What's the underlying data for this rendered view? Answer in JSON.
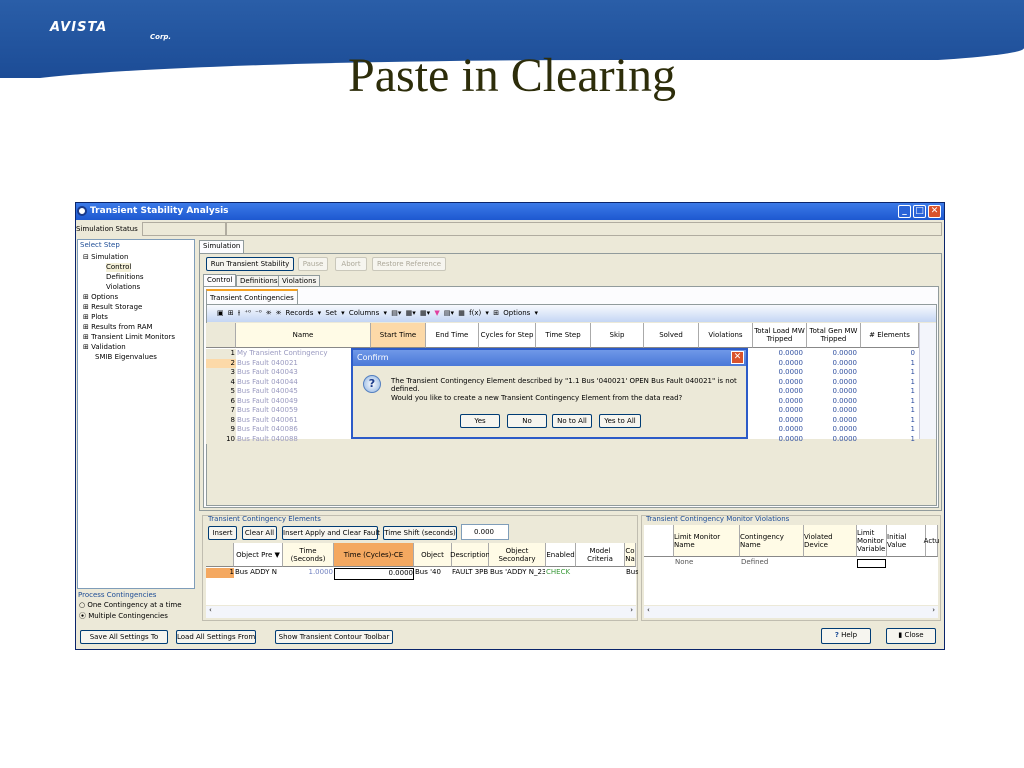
{
  "slide": {
    "logo": "AVISTA",
    "logo_sub": "Corp.",
    "title": "Paste in Clearing"
  },
  "window": {
    "title": "Transient Stability Analysis",
    "status_label": "Simulation Status"
  },
  "sidebar": {
    "header": "Select Step",
    "items": [
      {
        "label": "Simulation",
        "expander": "−"
      },
      {
        "label": "Control"
      },
      {
        "label": "Definitions"
      },
      {
        "label": "Violations"
      },
      {
        "label": "Options",
        "expander": "+"
      },
      {
        "label": "Result Storage",
        "expander": "+"
      },
      {
        "label": "Plots",
        "expander": "+"
      },
      {
        "label": "Results from RAM",
        "expander": "+"
      },
      {
        "label": "Transient Limit Monitors",
        "expander": "+"
      },
      {
        "label": "Validation",
        "expander": "+"
      },
      {
        "label": "SMIB Eigenvalues"
      }
    ],
    "process_header": "Process Contingencies",
    "process_options": [
      "One Contingency at a time",
      "Multiple Contingencies"
    ],
    "process_selected": 1
  },
  "main": {
    "tab": "Simulation",
    "buttons": {
      "run": "Run Transient Stability",
      "pause": "Pause",
      "abort": "Abort",
      "restore": "Restore Reference"
    },
    "subtabs": [
      "Control",
      "Definitions",
      "Violations"
    ],
    "inner_tab": "Transient Contingencies",
    "toolbar": {
      "records": "Records ▾",
      "set": "Set ▾",
      "columns": "Columns ▾",
      "fx": "f(x) ▾",
      "options": "Options ▾"
    },
    "columns": [
      "Name",
      "Start Time",
      "End Time",
      "Cycles for Step",
      "Time Step",
      "Skip",
      "Solved",
      "Violations",
      "Total Load MW Tripped",
      "Total Gen MW Tripped",
      "# Elements"
    ],
    "rows": [
      {
        "n": "1",
        "name": "My Transient Contingency",
        "load": "0.0000",
        "gen": "0.0000",
        "el": "0"
      },
      {
        "n": "2",
        "name": "Bus Fault 040021",
        "load": "0.0000",
        "gen": "0.0000",
        "el": "1"
      },
      {
        "n": "3",
        "name": "Bus Fault 040043",
        "load": "0.0000",
        "gen": "0.0000",
        "el": "1"
      },
      {
        "n": "4",
        "name": "Bus Fault 040044",
        "load": "0.0000",
        "gen": "0.0000",
        "el": "1"
      },
      {
        "n": "5",
        "name": "Bus Fault 040045",
        "load": "0.0000",
        "gen": "0.0000",
        "el": "1"
      },
      {
        "n": "6",
        "name": "Bus Fault 040049",
        "load": "0.0000",
        "gen": "0.0000",
        "el": "1"
      },
      {
        "n": "7",
        "name": "Bus Fault 040059",
        "load": "0.0000",
        "gen": "0.0000",
        "el": "1"
      },
      {
        "n": "8",
        "name": "Bus Fault 040061",
        "load": "0.0000",
        "gen": "0.0000",
        "el": "1"
      },
      {
        "n": "9",
        "name": "Bus Fault 040086",
        "load": "0.0000",
        "gen": "0.0000",
        "el": "1"
      },
      {
        "n": "10",
        "name": "Bus Fault 040088",
        "load": "0.0000",
        "gen": "0.0000",
        "el": "1"
      }
    ]
  },
  "elements": {
    "header": "Transient Contingency Elements",
    "buttons": {
      "insert": "Insert",
      "clear": "Clear All",
      "insert_apply": "Insert Apply and Clear Fault",
      "shift": "Time Shift (seconds)"
    },
    "shift_value": "0.000",
    "columns": [
      "Object Pre ▼",
      "Time (Seconds)",
      "Time (Cycles)-CE",
      "Object",
      "Description",
      "Object Secondary",
      "Enabled",
      "Model Criteria",
      "Co Na"
    ],
    "row": [
      "1",
      "Bus ADDY N",
      "1.0000",
      "0.0000",
      "Bus '40",
      "FAULT 3PB",
      "Bus 'ADDY N_230.",
      "CHECK",
      "",
      "Bus"
    ]
  },
  "violations": {
    "header": "Transient Contingency Monitor Violations",
    "columns": [
      "Limit Monitor Name",
      "Contingency Name",
      "Violated Device",
      "Limit Monitor Variable",
      "Initial Value",
      "Actu"
    ],
    "row": [
      "None",
      "Defined"
    ]
  },
  "footer": {
    "save": "Save All Settings To",
    "load": "Load All Settings From",
    "contour": "Show Transient Contour Toolbar",
    "help": "Help",
    "close": "Close"
  },
  "dialog": {
    "title": "Confirm",
    "line1": "The Transient Contingency Element described by \"1.1 Bus '040021' OPEN Bus Fault 040021\" is not defined.",
    "line2": "Would you like to create a new Transient Contingency Element from the data read?",
    "buttons": [
      "Yes",
      "No",
      "No to All",
      "Yes to All"
    ]
  }
}
